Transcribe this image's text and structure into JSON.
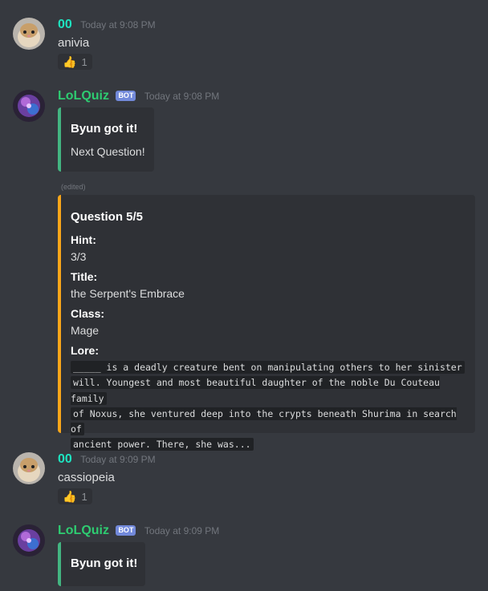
{
  "messages": [
    {
      "username": "00",
      "timestamp": "Today at 9:08 PM",
      "text": "anivia",
      "reaction": {
        "emoji": "👍",
        "count": "1"
      }
    },
    {
      "username": "LoLQuiz",
      "bot_tag": "BOT",
      "timestamp": "Today at 9:08 PM",
      "embed": {
        "title": "Byun got it!",
        "description": "Next Question!",
        "accent_color": "#43b581"
      },
      "edited_label": "(edited)",
      "question_embed": {
        "title": "Question 5/5",
        "accent_color": "#faa61a",
        "fields": [
          {
            "name": "Hint:",
            "value": "3/3"
          },
          {
            "name": "Title:",
            "value": "the Serpent's Embrace"
          },
          {
            "name": "Class:",
            "value": "Mage"
          }
        ],
        "lore_name": "Lore:",
        "lore_lines": [
          "_____ is a deadly creature bent on manipulating others to her sinister",
          "will. Youngest and most beautiful daughter of the noble Du Couteau family",
          "of Noxus, she ventured deep into the crypts beneath Shurima in search of",
          "ancient power. There, she was..."
        ]
      }
    },
    {
      "username": "00",
      "timestamp": "Today at 9:09 PM",
      "text": "cassiopeia",
      "reaction": {
        "emoji": "👍",
        "count": "1"
      }
    },
    {
      "username": "LoLQuiz",
      "bot_tag": "BOT",
      "timestamp": "Today at 9:09 PM",
      "embed": {
        "title": "Byun got it!",
        "accent_color": "#43b581"
      }
    }
  ],
  "icons": {
    "user_avatar": "hamster-avatar-icon",
    "bot_avatar": "lolquiz-avatar-icon",
    "reaction": "thumbs-up-icon"
  },
  "colors": {
    "background": "#36393f",
    "embed_background": "#2f3136",
    "user_name": "#1ee3c0",
    "bot_name": "#2ecc71",
    "bot_tag": "#7289da"
  }
}
